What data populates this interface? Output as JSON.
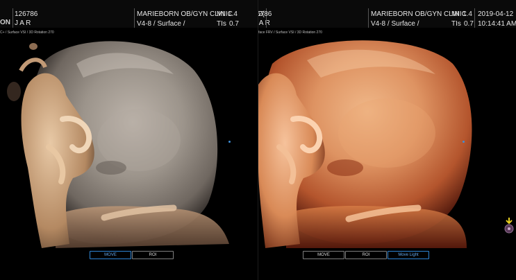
{
  "left_panel": {
    "patient_id": "126786",
    "patient_initials": "J A R",
    "logo_fragment": "ON",
    "clinic": "MARIEBORN OB/GYN CLINIC",
    "mi_label": "MI",
    "mi_value": "1.4",
    "probe": "V4-8 / Surface /",
    "tis_label": "TIs",
    "tis_value": "0.7",
    "info_line": "C+ / Surface VSI / 3D Rotation 270",
    "buttons": [
      "MOVE",
      "ROI"
    ]
  },
  "right_panel": {
    "patient_id_fragment": "2(",
    "patient_id": "126786",
    "patient_initials_fragment": "1J A R",
    "clinic": "MARIEBORN OB/GYN CLINIC",
    "mi_label": "MI",
    "mi_value": "1.4",
    "probe": "V4-8 / Surface /",
    "tis_label": "TIs",
    "tis_value": "0.7",
    "date": "2019-04-12",
    "time": "10:14:41 AM",
    "info_line": "face FRV / Surface VSI / 3D Rotation 270",
    "buttons": [
      "MOVE",
      "ROI",
      "Move Light"
    ]
  },
  "colors": {
    "active_border": "#2f86d6",
    "gray_render": "#a79d94",
    "warm_render": "#d98a57"
  },
  "icons": [
    "cursor-icon"
  ]
}
